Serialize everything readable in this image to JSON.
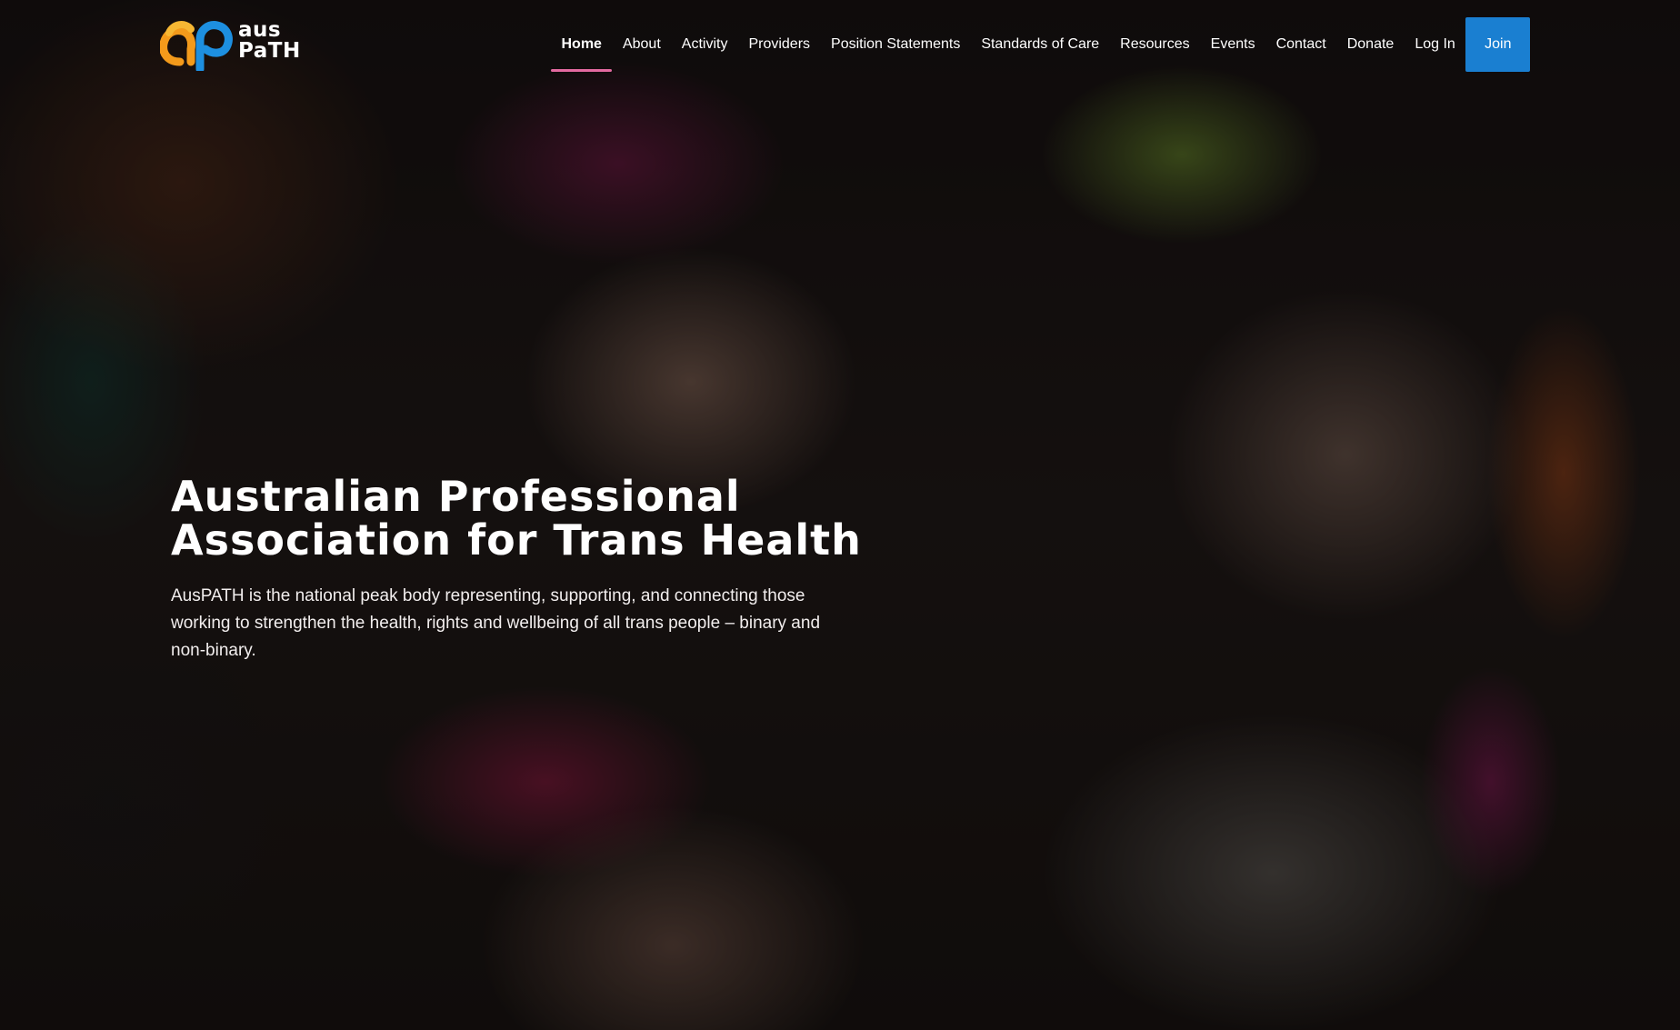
{
  "brand": {
    "line1": "aus",
    "line2": "PaTH",
    "colors": {
      "orange": "#f39a1b",
      "blue": "#1d8fe0",
      "accent_underline": "#e36aa0",
      "join_button": "#1a7fd1"
    }
  },
  "nav": {
    "items": [
      {
        "label": "Home",
        "active": true
      },
      {
        "label": "About"
      },
      {
        "label": "Activity"
      },
      {
        "label": "Providers"
      },
      {
        "label": "Position Statements"
      },
      {
        "label": "Standards of Care"
      },
      {
        "label": "Resources"
      },
      {
        "label": "Events"
      },
      {
        "label": "Contact"
      },
      {
        "label": "Donate"
      },
      {
        "label": "Log In"
      }
    ],
    "join_label": "Join"
  },
  "hero": {
    "title": "Australian Professional Association for Trans Health",
    "description": "AusPATH is the national peak body representing, supporting, and connecting those working to strengthen the health, rights and wellbeing of all trans people – binary and non-binary."
  }
}
